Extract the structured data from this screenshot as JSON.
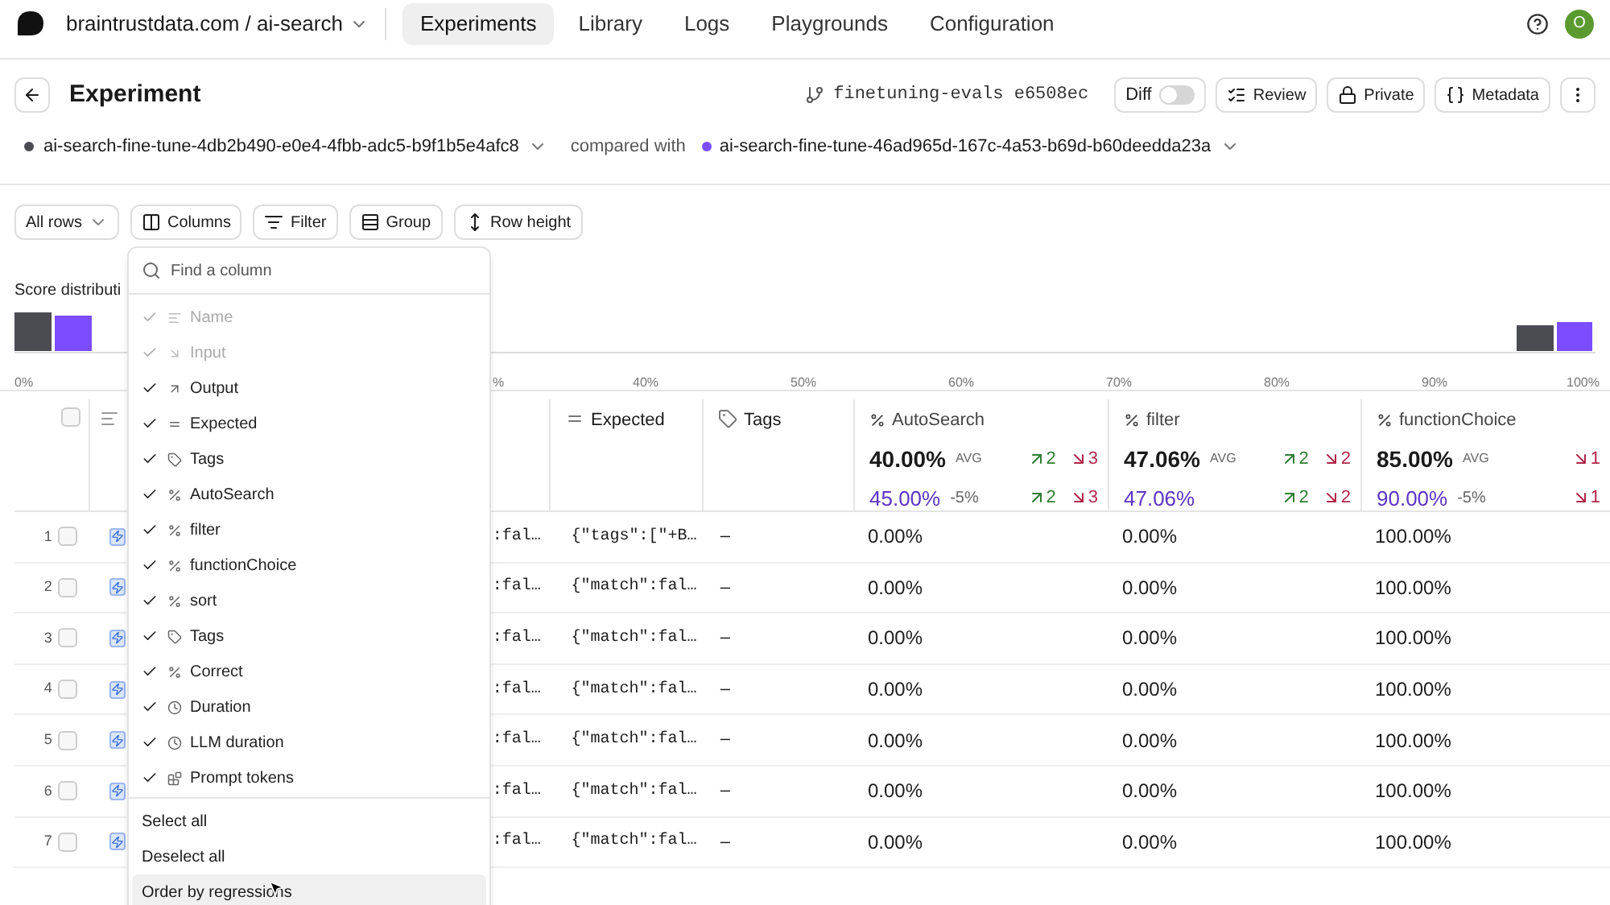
{
  "nav": {
    "project": "braintrustdata.com / ai-search",
    "tabs": [
      {
        "label": "Experiments",
        "selected": true
      },
      {
        "label": "Library",
        "selected": false
      },
      {
        "label": "Logs",
        "selected": false
      },
      {
        "label": "Playgrounds",
        "selected": false
      },
      {
        "label": "Configuration",
        "selected": false
      }
    ],
    "avatar": "O"
  },
  "header": {
    "title": "Experiment",
    "branch": "finetuning-evals e6508ec",
    "diff": {
      "label": "Diff",
      "on": false
    },
    "buttons": [
      {
        "kind": "review",
        "label": "Review"
      },
      {
        "kind": "private",
        "label": "Private"
      },
      {
        "kind": "metadata",
        "label": "Metadata"
      }
    ]
  },
  "comparison": {
    "base": {
      "name": "ai-search-fine-tune-4db2b490-e0e4-4fbb-adc5-b9f1b5e4afc8",
      "color": "#4b4b52"
    },
    "label": "compared with",
    "other": {
      "name": "ai-search-fine-tune-46ad965d-167c-4a53-b69d-b60deedda23a",
      "color": "#7c4dff"
    }
  },
  "toolbar": [
    {
      "kind": "rows",
      "label": "All rows"
    },
    {
      "kind": "columns",
      "label": "Columns"
    },
    {
      "kind": "filter",
      "label": "Filter"
    },
    {
      "kind": "group",
      "label": "Group"
    },
    {
      "kind": "height",
      "label": "Row height"
    }
  ],
  "score_distribution": {
    "title": "Score distributi",
    "ticks": [
      "0%",
      "%",
      "40%",
      "50%",
      "60%",
      "70%",
      "80%",
      "90%",
      "100%"
    ]
  },
  "column_menu": {
    "placeholder": "Find a column",
    "columns": [
      {
        "kind": "text",
        "label": "Name",
        "checked": true,
        "disabled": true
      },
      {
        "kind": "input",
        "label": "Input",
        "checked": true,
        "disabled": true
      },
      {
        "kind": "output",
        "label": "Output",
        "checked": true,
        "disabled": false
      },
      {
        "kind": "expected",
        "label": "Expected",
        "checked": true,
        "disabled": false
      },
      {
        "kind": "tag",
        "label": "Tags",
        "checked": true,
        "disabled": false
      },
      {
        "kind": "score",
        "label": "AutoSearch",
        "checked": true,
        "disabled": false
      },
      {
        "kind": "score",
        "label": "filter",
        "checked": true,
        "disabled": false
      },
      {
        "kind": "score",
        "label": "functionChoice",
        "checked": true,
        "disabled": false
      },
      {
        "kind": "score",
        "label": "sort",
        "checked": true,
        "disabled": false
      },
      {
        "kind": "tag",
        "label": "Tags",
        "checked": true,
        "disabled": false
      },
      {
        "kind": "score",
        "label": "Correct",
        "checked": true,
        "disabled": false
      },
      {
        "kind": "duration",
        "label": "Duration",
        "checked": true,
        "disabled": false
      },
      {
        "kind": "duration",
        "label": "LLM duration",
        "checked": true,
        "disabled": false
      },
      {
        "kind": "tokens",
        "label": "Prompt tokens",
        "checked": true,
        "disabled": false
      }
    ],
    "actions": [
      {
        "label": "Select all",
        "selected": false
      },
      {
        "label": "Deselect all",
        "selected": false
      },
      {
        "label": "Order by regressions",
        "selected": true
      }
    ]
  },
  "table": {
    "select_all": {
      "checked": false
    },
    "columns": [
      {
        "kind": "expected",
        "label": "Expected"
      },
      {
        "kind": "tag",
        "label": "Tags"
      }
    ],
    "scores": [
      {
        "name": "AutoSearch",
        "avg": "40.00%",
        "avg_label": "AVG",
        "up": "2",
        "down": "3",
        "compare": {
          "value": "45.00%",
          "diff": "-5%",
          "up": "2",
          "down": "3"
        }
      },
      {
        "name": "filter",
        "avg": "47.06%",
        "avg_label": "AVG",
        "up": "2",
        "down": "2",
        "compare": {
          "value": "47.06%",
          "up": "2",
          "down": "2"
        }
      },
      {
        "name": "functionChoice",
        "avg": "85.00%",
        "avg_label": "AVG",
        "down": "1",
        "compare": {
          "value": "90.00%",
          "diff": "-5%",
          "down": "1"
        }
      }
    ],
    "rows": [
      {
        "number": "1",
        "checked": false,
        "output": ":fal…",
        "expected": "{\"tags\":[\"+B…",
        "tags": "–",
        "scores": [
          "0.00%",
          "0.00%",
          "100.00%"
        ]
      },
      {
        "number": "2",
        "checked": false,
        "output": ":fal…",
        "expected": "{\"match\":fal…",
        "tags": "–",
        "scores": [
          "0.00%",
          "0.00%",
          "100.00%"
        ]
      },
      {
        "number": "3",
        "checked": false,
        "output": ":fal…",
        "expected": "{\"match\":fal…",
        "tags": "–",
        "scores": [
          "0.00%",
          "0.00%",
          "100.00%"
        ]
      },
      {
        "number": "4",
        "checked": false,
        "output": ":fal…",
        "expected": "{\"match\":fal…",
        "tags": "–",
        "scores": [
          "0.00%",
          "0.00%",
          "100.00%"
        ]
      },
      {
        "number": "5",
        "checked": false,
        "output": ":fal…",
        "expected": "{\"match\":fal…",
        "tags": "–",
        "scores": [
          "0.00%",
          "0.00%",
          "100.00%"
        ]
      },
      {
        "number": "6",
        "checked": false,
        "output": ":fal…",
        "expected": "{\"match\":fal…",
        "tags": "–",
        "scores": [
          "0.00%",
          "0.00%",
          "100.00%"
        ]
      },
      {
        "number": "7",
        "checked": false,
        "output": ":fal…",
        "expected": "{\"match\":fal…",
        "tags": "–",
        "scores": [
          "0.00%",
          "0.00%",
          "100.00%"
        ]
      }
    ]
  }
}
